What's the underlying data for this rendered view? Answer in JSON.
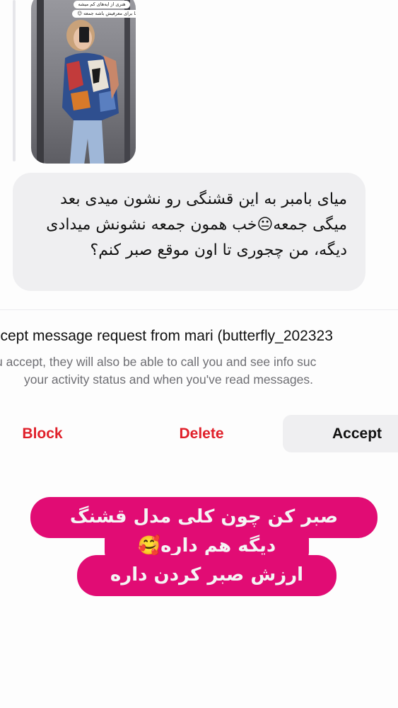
{
  "story": {
    "sticker_top": "هنری از ایه‌های کم میشه",
    "sticker_bottom": "وعده ما برای معرفیش باشه جمعه 😉"
  },
  "message": {
    "text": "میای بامبر به این قشنگی رو نشون میدی بعد میگی جمعه😐خب همون جمعه نشونش میدادی دیگه، من چجوری تا اون موقع صبر کنم؟"
  },
  "request": {
    "title": "ccept message request from mari (butterfly_202323",
    "description_line1": "u accept, they will also be able to call you and see info suc",
    "description_line2": "your activity status and when you've read messages."
  },
  "actions": {
    "block": "Block",
    "delete": "Delete",
    "accept": "Accept"
  },
  "caption": {
    "line1": "صبر کن چون کلی مدل قشنگ",
    "line2": "دیگه هم داره🥰",
    "line3": "ارزش صبر کردن داره"
  },
  "colors": {
    "danger": "#e0202a",
    "caption_bg": "#e10c74",
    "bubble_bg": "#efeff1"
  }
}
